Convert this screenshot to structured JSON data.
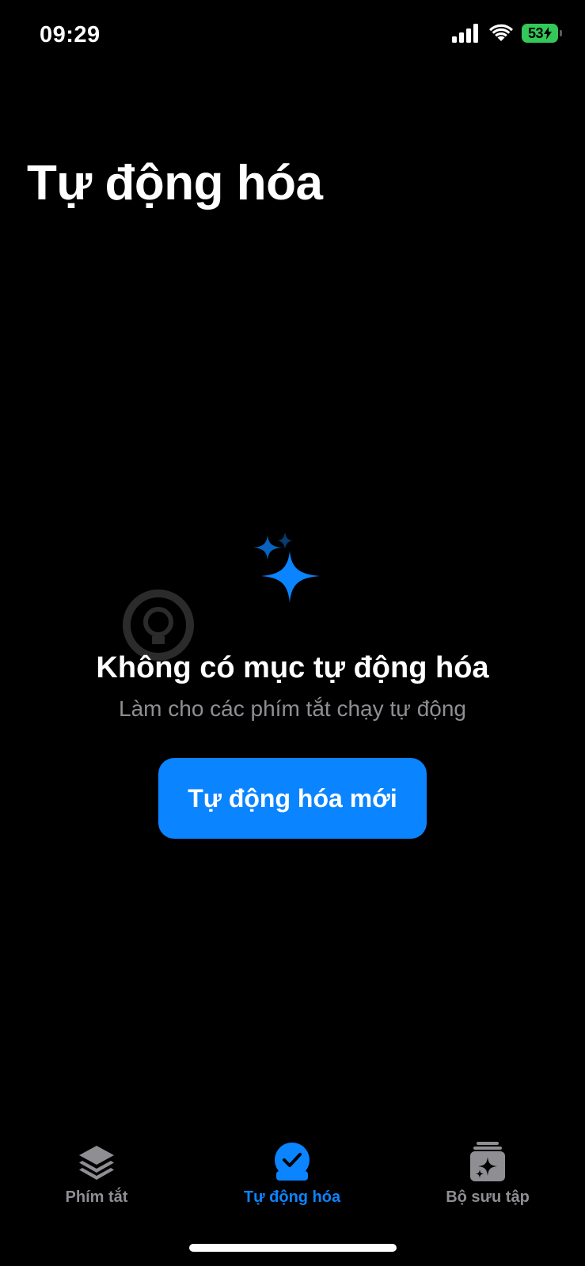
{
  "status_bar": {
    "time": "09:29",
    "battery": "53"
  },
  "page_title": "Tự động hóa",
  "empty_state": {
    "title": "Không có mục tự động hóa",
    "subtitle": "Làm cho các phím tắt chạy tự động",
    "button_label": "Tự động hóa mới"
  },
  "tab_bar": {
    "tabs": [
      {
        "label": "Phím tắt",
        "icon": "layers-icon",
        "active": false
      },
      {
        "label": "Tự động hóa",
        "icon": "clock-check-icon",
        "active": true
      },
      {
        "label": "Bộ sưu tập",
        "icon": "gallery-sparkle-icon",
        "active": false
      }
    ]
  },
  "colors": {
    "accent": "#0a84ff",
    "background": "#000000",
    "inactive": "#8e8e93",
    "battery": "#34c759"
  }
}
